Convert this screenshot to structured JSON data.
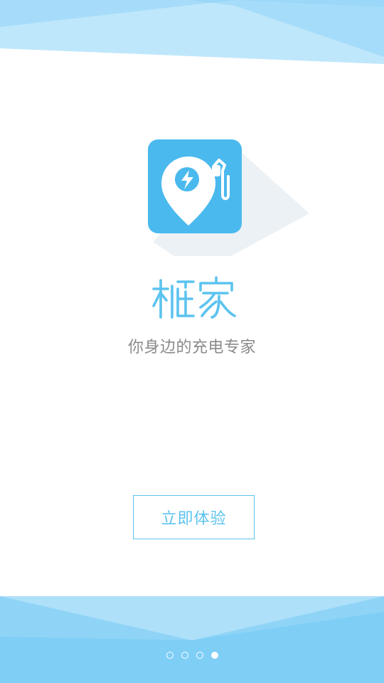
{
  "colors": {
    "accent": "#5cc3ef",
    "icon_background": "#4ab9ee",
    "wave_light": "#bfe7fb",
    "wave_mid": "#8fd4f7",
    "tagline": "#8a8a8a"
  },
  "app": {
    "icon": "charging-location-pin-icon",
    "name": "桩家",
    "tagline": "你身边的充电专家"
  },
  "cta": {
    "label": "立即体验"
  },
  "pagination": {
    "total": 4,
    "current": 4
  }
}
